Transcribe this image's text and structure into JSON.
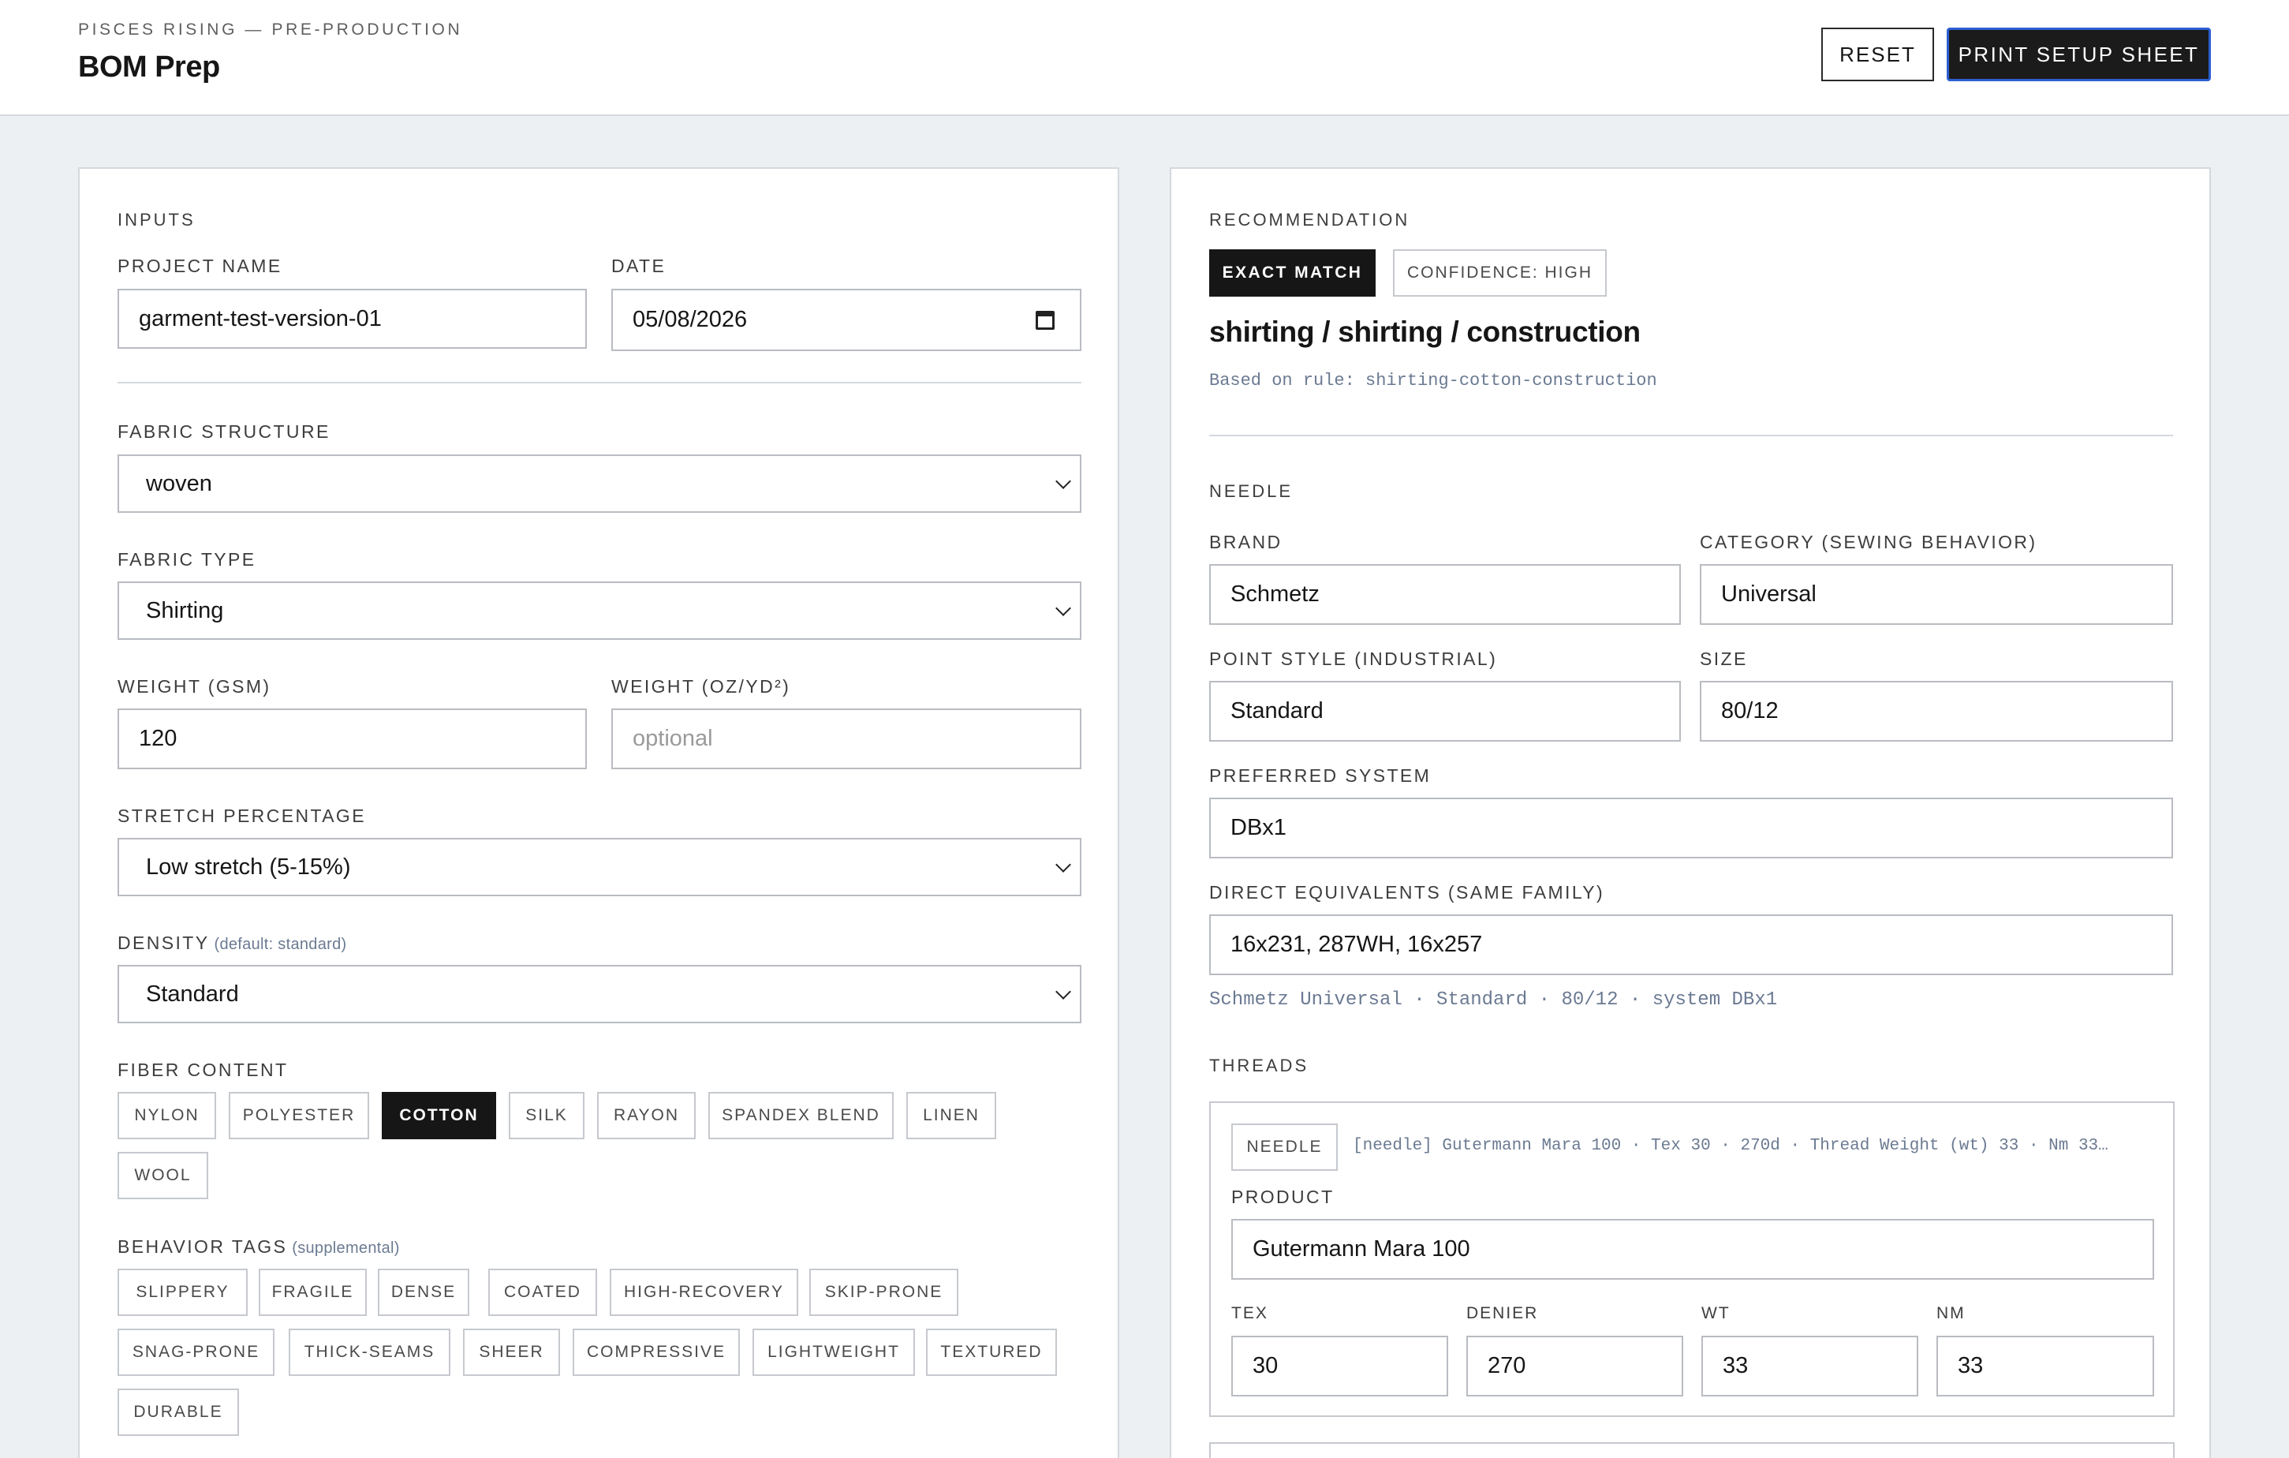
{
  "header": {
    "eyebrow": "PISCES RISING — PRE-PRODUCTION",
    "title": "BOM Prep",
    "reset_label": "RESET",
    "print_label": "PRINT SETUP SHEET"
  },
  "inputs": {
    "section_label": "INPUTS",
    "project_name": {
      "label": "PROJECT NAME",
      "value": "garment-test-version-01"
    },
    "date": {
      "label": "DATE",
      "value": "05/08/2026"
    },
    "fabric_structure": {
      "label": "FABRIC STRUCTURE",
      "value": "woven"
    },
    "fabric_type": {
      "label": "FABRIC TYPE",
      "value": "Shirting"
    },
    "weight_gsm": {
      "label": "WEIGHT (GSM)",
      "value": "120"
    },
    "weight_oz": {
      "label": "WEIGHT (OZ/YD²)",
      "placeholder": "optional"
    },
    "stretch": {
      "label": "STRETCH PERCENTAGE",
      "value": "Low stretch (5-15%)"
    },
    "density": {
      "label": "DENSITY",
      "hint": "(default: standard)",
      "value": "Standard"
    },
    "fiber_content": {
      "label": "FIBER CONTENT",
      "options": [
        "NYLON",
        "POLYESTER",
        "COTTON",
        "SILK",
        "RAYON",
        "SPANDEX BLEND",
        "LINEN",
        "WOOL"
      ],
      "selected": "COTTON"
    },
    "behavior_tags": {
      "label": "BEHAVIOR TAGS",
      "hint": "(supplemental)",
      "options": [
        "SLIPPERY",
        "FRAGILE",
        "DENSE",
        "COATED",
        "HIGH-RECOVERY",
        "SKIP-PRONE",
        "SNAG-PRONE",
        "THICK-SEAMS",
        "SHEER",
        "COMPRESSIVE",
        "LIGHTWEIGHT",
        "TEXTURED",
        "DURABLE"
      ]
    }
  },
  "recommendation": {
    "section_label": "RECOMMENDATION",
    "match_badge": "EXACT MATCH",
    "confidence_badge": "CONFIDENCE: HIGH",
    "title": "shirting / shirting / construction",
    "rule_note": "Based on rule: shirting-cotton-construction",
    "needle": {
      "section_label": "NEEDLE",
      "brand": {
        "label": "BRAND",
        "value": "Schmetz"
      },
      "category": {
        "label": "CATEGORY (SEWING BEHAVIOR)",
        "value": "Universal"
      },
      "point_style": {
        "label": "POINT STYLE (INDUSTRIAL)",
        "value": "Standard"
      },
      "size": {
        "label": "SIZE",
        "value": "80/12"
      },
      "preferred_system": {
        "label": "PREFERRED SYSTEM",
        "value": "DBx1"
      },
      "equivalents": {
        "label": "DIRECT EQUIVALENTS (SAME FAMILY)",
        "value": "16x231, 287WH, 16x257"
      },
      "summary": "Schmetz Universal · Standard · 80/12 · system DBx1"
    },
    "threads": {
      "section_label": "THREADS",
      "tab": "NEEDLE",
      "summary": "[needle] Gutermann Mara 100 · Tex 30 · 270d · Thread Weight (wt) 33 · Nm 33…",
      "product": {
        "label": "PRODUCT",
        "value": "Gutermann Mara 100"
      },
      "tex": {
        "label": "TEX",
        "value": "30"
      },
      "denier": {
        "label": "DENIER",
        "value": "270"
      },
      "wt": {
        "label": "WT",
        "value": "33"
      },
      "nm": {
        "label": "NM",
        "value": "33"
      }
    }
  }
}
